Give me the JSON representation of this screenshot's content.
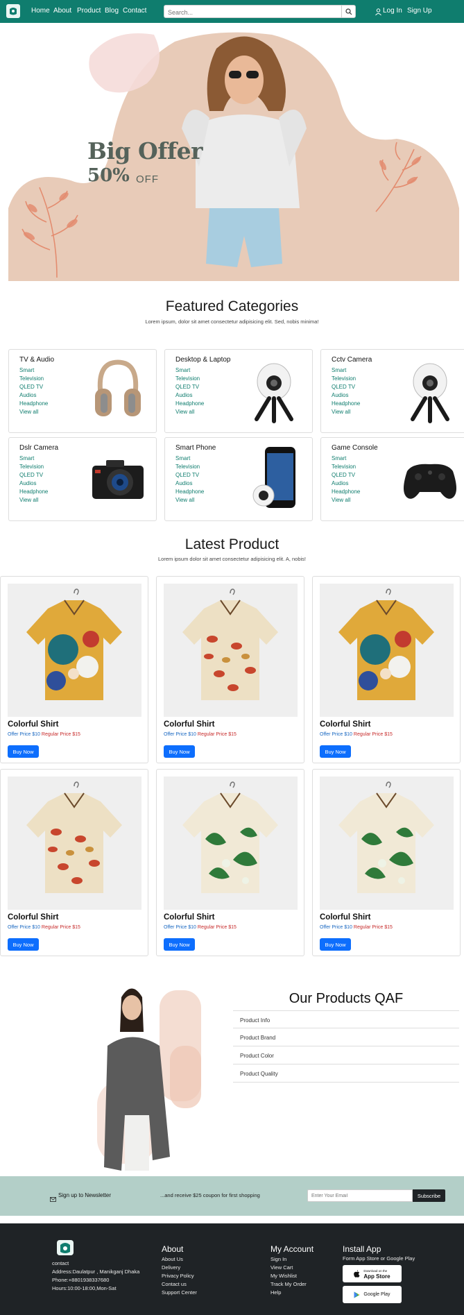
{
  "nav": {
    "links": [
      "Home",
      "About",
      "Product",
      "Blog",
      "Contact"
    ],
    "search_placeholder": "Search...",
    "login": "Log In",
    "signup": "Sign Up"
  },
  "hero": {
    "title": "Big Offer",
    "percent": "50%",
    "off": "OFF"
  },
  "categories_section": {
    "title": "Featured Categories",
    "subtitle": "Lorem ipsum, dolor sit amet consectetur adipisicing elit. Sed, nobis minima!"
  },
  "categories": [
    {
      "title": "TV & Audio",
      "items": [
        "Smart",
        "Television",
        "QLED TV",
        "Audios",
        "Headphone",
        "View all"
      ],
      "image": "headphones"
    },
    {
      "title": "Desktop & Laptop",
      "items": [
        "Smart",
        "Television",
        "QLED TV",
        "Audios",
        "Headphone",
        "View all"
      ],
      "image": "360-camera"
    },
    {
      "title": "Cctv Camera",
      "items": [
        "Smart",
        "Television",
        "QLED TV",
        "Audios",
        "Headphone",
        "View all"
      ],
      "image": "360-camera"
    },
    {
      "title": "Dslr Camera",
      "items": [
        "Smart",
        "Television",
        "QLED TV",
        "Audios",
        "Headphone",
        "View all"
      ],
      "image": "dslr-camera"
    },
    {
      "title": "Smart Phone",
      "items": [
        "Smart",
        "Television",
        "QLED TV",
        "Audios",
        "Headphone",
        "View all"
      ],
      "image": "smartphone"
    },
    {
      "title": "Game Console",
      "items": [
        "Smart",
        "Television",
        "QLED TV",
        "Audios",
        "Headphone",
        "View all"
      ],
      "image": "gamepad"
    }
  ],
  "latest_section": {
    "title": "Latest Product",
    "subtitle": "Lorem ipsum dolor sit amet consectetur adipisicing elit. A, nobis!"
  },
  "products": [
    {
      "name": "Colorful Shirt",
      "offer": "Offer Price $10",
      "regular": "Regular Price $15",
      "button": "Buy Now",
      "pattern": "abstract"
    },
    {
      "name": "Colorful Shirt",
      "offer": "Offer Price $10",
      "regular": "Regular Price $15",
      "button": "Buy Now",
      "pattern": "mushroom"
    },
    {
      "name": "Colorful Shirt",
      "offer": "Offer Price $10",
      "regular": "Regular Price $15",
      "button": "Buy Now",
      "pattern": "abstract"
    },
    {
      "name": "Colorful Shirt",
      "offer": "Offer Price $10",
      "regular": "Regular Price $15",
      "button": "Buy Now",
      "pattern": "mushroom"
    },
    {
      "name": "Colorful Shirt",
      "offer": "Offer Price $10",
      "regular": "Regular Price $15",
      "button": "Buy Now",
      "pattern": "tropical"
    },
    {
      "name": "Colorful Shirt",
      "offer": "Offer Price $10",
      "regular": "Regular Price $15",
      "button": "Buy Now",
      "pattern": "tropical"
    }
  ],
  "faq": {
    "title": "Our Products QAF",
    "items": [
      "Product Info",
      "Product Brand",
      "Product Color",
      "Product Quality"
    ]
  },
  "newsletter": {
    "label": "Sign up to Newsletter",
    "text": "...and receive $25 coupon for first shopping",
    "placeholder": "Enter Your Email",
    "button": "Subscribe"
  },
  "footer": {
    "contact_heading": "contact",
    "address": "Address:Daulatpur , Manikganj Dhaka",
    "phone": "Phone:+8801938337680",
    "hours": "Hours:10:00-18:00,Mon-Sat",
    "about": {
      "heading": "About",
      "links": [
        "About Us",
        "Delivery",
        "Privacy Policy",
        "Contact us",
        "Support Center"
      ]
    },
    "account": {
      "heading": "My Account",
      "links": [
        "Sign In",
        "View Cart",
        "My Wishlist",
        "Track My Order",
        "Help"
      ]
    },
    "app": {
      "heading": "Install App",
      "text": "Form App Store or Google Play",
      "appstore_small": "Download on the",
      "appstore": "App Store",
      "googleplay": "Google Play"
    }
  },
  "colors": {
    "brand": "#0f7d6e",
    "button": "#0d6efd",
    "newsletter_bg": "#b3cfc8",
    "footer_bg": "#1f2326"
  }
}
